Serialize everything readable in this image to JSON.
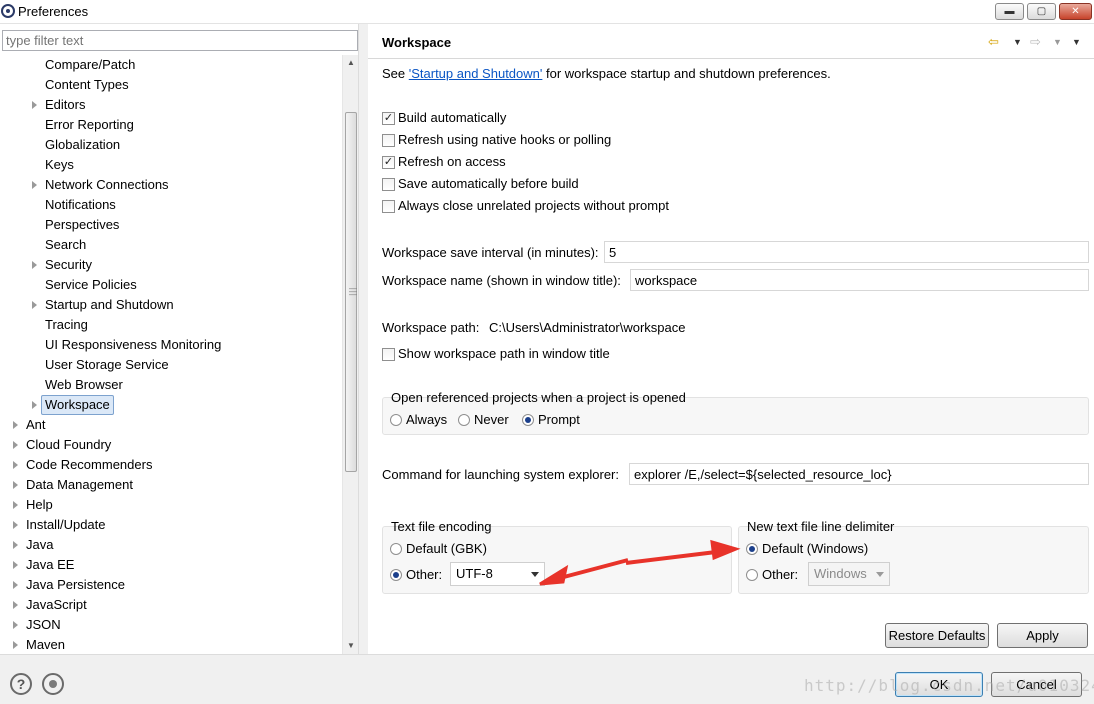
{
  "window": {
    "title": "Preferences",
    "minimize_label": "▬",
    "maximize_label": "▢",
    "close_label": "✕"
  },
  "filter": {
    "placeholder": "type filter text"
  },
  "tree": {
    "items": [
      {
        "label": "Compare/Patch",
        "expandable": false,
        "level": 1
      },
      {
        "label": "Content Types",
        "expandable": false,
        "level": 1
      },
      {
        "label": "Editors",
        "expandable": true,
        "level": 1
      },
      {
        "label": "Error Reporting",
        "expandable": false,
        "level": 1
      },
      {
        "label": "Globalization",
        "expandable": false,
        "level": 1
      },
      {
        "label": "Keys",
        "expandable": false,
        "level": 1
      },
      {
        "label": "Network Connections",
        "expandable": true,
        "level": 1
      },
      {
        "label": "Notifications",
        "expandable": false,
        "level": 1
      },
      {
        "label": "Perspectives",
        "expandable": false,
        "level": 1
      },
      {
        "label": "Search",
        "expandable": false,
        "level": 1
      },
      {
        "label": "Security",
        "expandable": true,
        "level": 1
      },
      {
        "label": "Service Policies",
        "expandable": false,
        "level": 1
      },
      {
        "label": "Startup and Shutdown",
        "expandable": true,
        "level": 1
      },
      {
        "label": "Tracing",
        "expandable": false,
        "level": 1
      },
      {
        "label": "UI Responsiveness Monitoring",
        "expandable": false,
        "level": 1
      },
      {
        "label": "User Storage Service",
        "expandable": false,
        "level": 1
      },
      {
        "label": "Web Browser",
        "expandable": false,
        "level": 1
      },
      {
        "label": "Workspace",
        "expandable": true,
        "level": 1,
        "selected": true
      },
      {
        "label": "Ant",
        "expandable": true,
        "level": 0
      },
      {
        "label": "Cloud Foundry",
        "expandable": true,
        "level": 0
      },
      {
        "label": "Code Recommenders",
        "expandable": true,
        "level": 0
      },
      {
        "label": "Data Management",
        "expandable": true,
        "level": 0
      },
      {
        "label": "Help",
        "expandable": true,
        "level": 0
      },
      {
        "label": "Install/Update",
        "expandable": true,
        "level": 0
      },
      {
        "label": "Java",
        "expandable": true,
        "level": 0
      },
      {
        "label": "Java EE",
        "expandable": true,
        "level": 0
      },
      {
        "label": "Java Persistence",
        "expandable": true,
        "level": 0
      },
      {
        "label": "JavaScript",
        "expandable": true,
        "level": 0
      },
      {
        "label": "JSON",
        "expandable": true,
        "level": 0
      },
      {
        "label": "Maven",
        "expandable": true,
        "level": 0
      }
    ]
  },
  "page": {
    "title": "Workspace",
    "see_prefix": "See ",
    "see_link": "'Startup and Shutdown'",
    "see_suffix": " for workspace startup and shutdown preferences.",
    "checkboxes": [
      {
        "label": "Build automatically",
        "checked": true
      },
      {
        "label": "Refresh using native hooks or polling",
        "checked": false
      },
      {
        "label": "Refresh on access",
        "checked": true
      },
      {
        "label": "Save automatically before build",
        "checked": false
      },
      {
        "label": "Always close unrelated projects without prompt",
        "checked": false
      }
    ],
    "save_interval_label": "Workspace save interval (in minutes):",
    "save_interval_value": "5",
    "workspace_name_label": "Workspace name (shown in window title):",
    "workspace_name_value": "workspace",
    "workspace_path_label": "Workspace path:",
    "workspace_path_value": "C:\\Users\\Administrator\\workspace",
    "show_path_label": "Show workspace path in window title",
    "open_projects": {
      "title": "Open referenced projects when a project is opened",
      "options": [
        "Always",
        "Never",
        "Prompt"
      ],
      "selected": "Prompt"
    },
    "explorer_label": "Command for launching system explorer:",
    "explorer_value": "explorer /E,/select=${selected_resource_loc}",
    "encoding": {
      "title": "Text file encoding",
      "default_label": "Default (GBK)",
      "other_label": "Other:",
      "other_value": "UTF-8",
      "selected": "other"
    },
    "delimiter": {
      "title": "New text file line delimiter",
      "default_label": "Default (Windows)",
      "other_label": "Other:",
      "other_value": "Windows",
      "selected": "default"
    },
    "restore_defaults_label": "Restore Defaults",
    "apply_label": "Apply"
  },
  "footer": {
    "help_label": "?",
    "ok_label": "OK",
    "cancel_label": "Cancel",
    "watermark": "http://blog.csdn.net/u010324"
  },
  "colors": {
    "annotation_arrow": "#e8332a",
    "link": "#0a55c4",
    "selection": "#dbe8f7"
  }
}
